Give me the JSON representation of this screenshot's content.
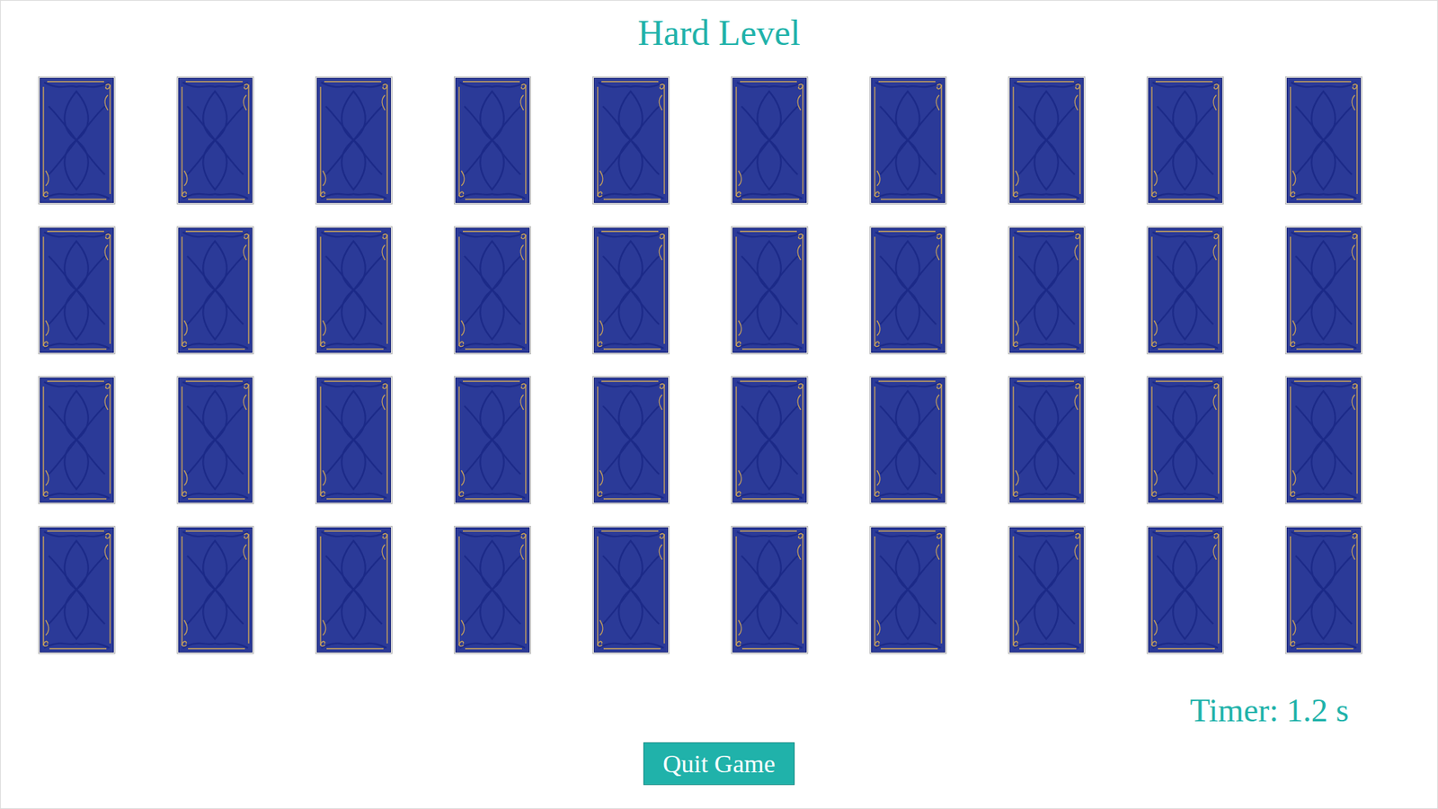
{
  "title": "Hard Level",
  "cards": [
    {
      "face_up": false
    },
    {
      "face_up": false
    },
    {
      "face_up": false
    },
    {
      "face_up": false
    },
    {
      "face_up": false
    },
    {
      "face_up": false
    },
    {
      "face_up": false
    },
    {
      "face_up": false
    },
    {
      "face_up": false
    },
    {
      "face_up": false
    },
    {
      "face_up": false
    },
    {
      "face_up": false
    },
    {
      "face_up": false
    },
    {
      "face_up": false
    },
    {
      "face_up": false
    },
    {
      "face_up": false
    },
    {
      "face_up": false
    },
    {
      "face_up": false
    },
    {
      "face_up": false
    },
    {
      "face_up": false
    },
    {
      "face_up": false
    },
    {
      "face_up": false
    },
    {
      "face_up": false
    },
    {
      "face_up": false
    },
    {
      "face_up": false
    },
    {
      "face_up": false
    },
    {
      "face_up": false
    },
    {
      "face_up": false
    },
    {
      "face_up": false
    },
    {
      "face_up": false
    },
    {
      "face_up": false
    },
    {
      "face_up": false
    },
    {
      "face_up": false
    },
    {
      "face_up": false
    },
    {
      "face_up": false
    },
    {
      "face_up": false
    },
    {
      "face_up": false
    },
    {
      "face_up": false
    },
    {
      "face_up": false
    },
    {
      "face_up": false
    }
  ],
  "timer": "Timer: 1.2 s",
  "quit_button": "Quit Game"
}
